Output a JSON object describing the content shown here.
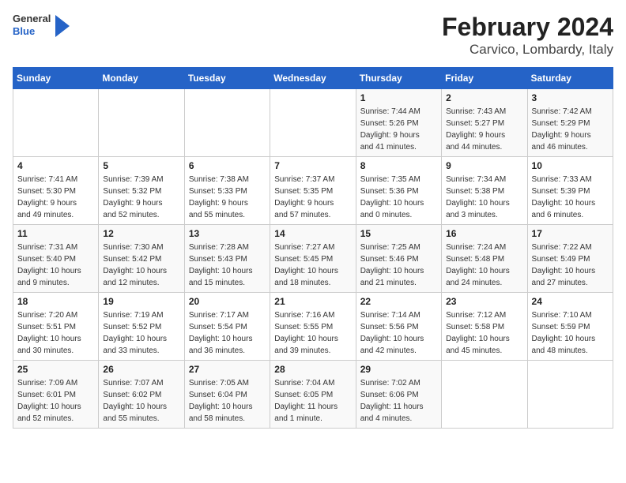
{
  "header": {
    "logo": {
      "general": "General",
      "blue": "Blue"
    },
    "title": "February 2024",
    "subtitle": "Carvico, Lombardy, Italy"
  },
  "days_of_week": [
    "Sunday",
    "Monday",
    "Tuesday",
    "Wednesday",
    "Thursday",
    "Friday",
    "Saturday"
  ],
  "weeks": [
    [
      {
        "day": "",
        "info": ""
      },
      {
        "day": "",
        "info": ""
      },
      {
        "day": "",
        "info": ""
      },
      {
        "day": "",
        "info": ""
      },
      {
        "day": "1",
        "info": "Sunrise: 7:44 AM\nSunset: 5:26 PM\nDaylight: 9 hours\nand 41 minutes."
      },
      {
        "day": "2",
        "info": "Sunrise: 7:43 AM\nSunset: 5:27 PM\nDaylight: 9 hours\nand 44 minutes."
      },
      {
        "day": "3",
        "info": "Sunrise: 7:42 AM\nSunset: 5:29 PM\nDaylight: 9 hours\nand 46 minutes."
      }
    ],
    [
      {
        "day": "4",
        "info": "Sunrise: 7:41 AM\nSunset: 5:30 PM\nDaylight: 9 hours\nand 49 minutes."
      },
      {
        "day": "5",
        "info": "Sunrise: 7:39 AM\nSunset: 5:32 PM\nDaylight: 9 hours\nand 52 minutes."
      },
      {
        "day": "6",
        "info": "Sunrise: 7:38 AM\nSunset: 5:33 PM\nDaylight: 9 hours\nand 55 minutes."
      },
      {
        "day": "7",
        "info": "Sunrise: 7:37 AM\nSunset: 5:35 PM\nDaylight: 9 hours\nand 57 minutes."
      },
      {
        "day": "8",
        "info": "Sunrise: 7:35 AM\nSunset: 5:36 PM\nDaylight: 10 hours\nand 0 minutes."
      },
      {
        "day": "9",
        "info": "Sunrise: 7:34 AM\nSunset: 5:38 PM\nDaylight: 10 hours\nand 3 minutes."
      },
      {
        "day": "10",
        "info": "Sunrise: 7:33 AM\nSunset: 5:39 PM\nDaylight: 10 hours\nand 6 minutes."
      }
    ],
    [
      {
        "day": "11",
        "info": "Sunrise: 7:31 AM\nSunset: 5:40 PM\nDaylight: 10 hours\nand 9 minutes."
      },
      {
        "day": "12",
        "info": "Sunrise: 7:30 AM\nSunset: 5:42 PM\nDaylight: 10 hours\nand 12 minutes."
      },
      {
        "day": "13",
        "info": "Sunrise: 7:28 AM\nSunset: 5:43 PM\nDaylight: 10 hours\nand 15 minutes."
      },
      {
        "day": "14",
        "info": "Sunrise: 7:27 AM\nSunset: 5:45 PM\nDaylight: 10 hours\nand 18 minutes."
      },
      {
        "day": "15",
        "info": "Sunrise: 7:25 AM\nSunset: 5:46 PM\nDaylight: 10 hours\nand 21 minutes."
      },
      {
        "day": "16",
        "info": "Sunrise: 7:24 AM\nSunset: 5:48 PM\nDaylight: 10 hours\nand 24 minutes."
      },
      {
        "day": "17",
        "info": "Sunrise: 7:22 AM\nSunset: 5:49 PM\nDaylight: 10 hours\nand 27 minutes."
      }
    ],
    [
      {
        "day": "18",
        "info": "Sunrise: 7:20 AM\nSunset: 5:51 PM\nDaylight: 10 hours\nand 30 minutes."
      },
      {
        "day": "19",
        "info": "Sunrise: 7:19 AM\nSunset: 5:52 PM\nDaylight: 10 hours\nand 33 minutes."
      },
      {
        "day": "20",
        "info": "Sunrise: 7:17 AM\nSunset: 5:54 PM\nDaylight: 10 hours\nand 36 minutes."
      },
      {
        "day": "21",
        "info": "Sunrise: 7:16 AM\nSunset: 5:55 PM\nDaylight: 10 hours\nand 39 minutes."
      },
      {
        "day": "22",
        "info": "Sunrise: 7:14 AM\nSunset: 5:56 PM\nDaylight: 10 hours\nand 42 minutes."
      },
      {
        "day": "23",
        "info": "Sunrise: 7:12 AM\nSunset: 5:58 PM\nDaylight: 10 hours\nand 45 minutes."
      },
      {
        "day": "24",
        "info": "Sunrise: 7:10 AM\nSunset: 5:59 PM\nDaylight: 10 hours\nand 48 minutes."
      }
    ],
    [
      {
        "day": "25",
        "info": "Sunrise: 7:09 AM\nSunset: 6:01 PM\nDaylight: 10 hours\nand 52 minutes."
      },
      {
        "day": "26",
        "info": "Sunrise: 7:07 AM\nSunset: 6:02 PM\nDaylight: 10 hours\nand 55 minutes."
      },
      {
        "day": "27",
        "info": "Sunrise: 7:05 AM\nSunset: 6:04 PM\nDaylight: 10 hours\nand 58 minutes."
      },
      {
        "day": "28",
        "info": "Sunrise: 7:04 AM\nSunset: 6:05 PM\nDaylight: 11 hours\nand 1 minute."
      },
      {
        "day": "29",
        "info": "Sunrise: 7:02 AM\nSunset: 6:06 PM\nDaylight: 11 hours\nand 4 minutes."
      },
      {
        "day": "",
        "info": ""
      },
      {
        "day": "",
        "info": ""
      }
    ]
  ]
}
